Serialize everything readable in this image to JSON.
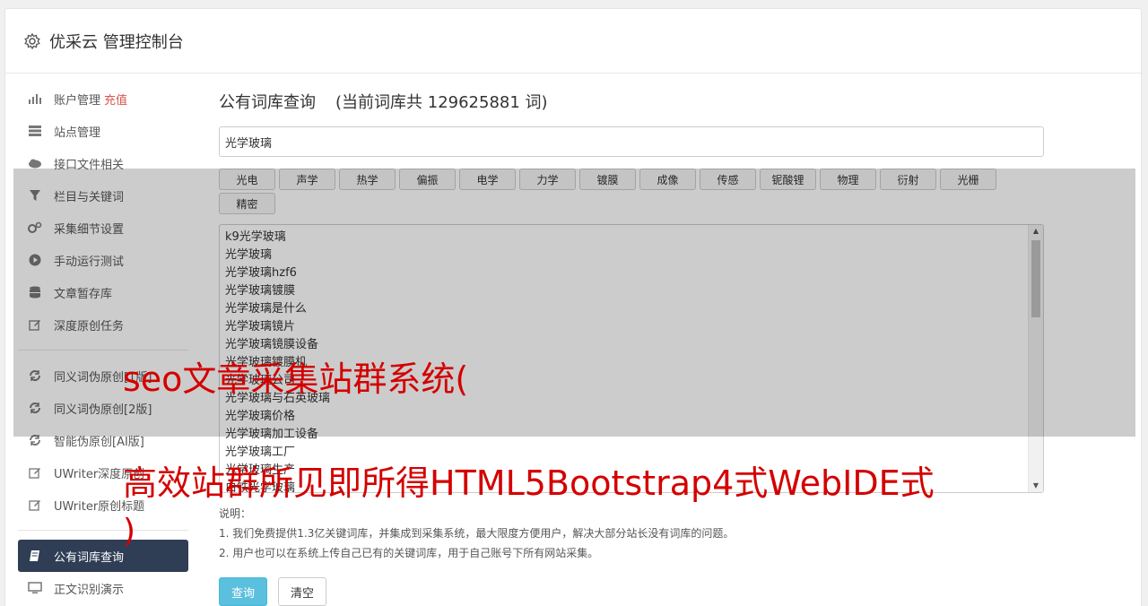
{
  "header": {
    "title": "优采云 管理控制台",
    "icon": "gear-icon"
  },
  "sidebar": {
    "items": [
      {
        "label": "账户管理",
        "extra": "充值",
        "icon": "bar-chart-icon"
      },
      {
        "label": "站点管理",
        "icon": "server-icon"
      },
      {
        "label": "接口文件相关",
        "icon": "cloud-upload-icon"
      },
      {
        "label": "栏目与关键词",
        "icon": "filter-icon"
      },
      {
        "label": "采集细节设置",
        "icon": "gears-icon"
      },
      {
        "label": "手动运行测试",
        "icon": "play-circle-icon"
      },
      {
        "label": "文章暂存库",
        "icon": "database-icon"
      },
      {
        "label": "深度原创任务",
        "icon": "edit-icon"
      },
      {
        "label": "同义词伪原创[1版]",
        "icon": "refresh-icon"
      },
      {
        "label": "同义词伪原创[2版]",
        "icon": "refresh-icon"
      },
      {
        "label": "智能伪原创[AI版]",
        "icon": "refresh-icon"
      },
      {
        "label": "UWriter深度原创",
        "icon": "edit-icon"
      },
      {
        "label": "UWriter原创标题",
        "icon": "edit-icon"
      },
      {
        "label": "公有词库查询",
        "icon": "book-icon"
      },
      {
        "label": "正文识别演示",
        "icon": "monitor-icon"
      }
    ]
  },
  "main": {
    "title": "公有词库查询",
    "count_text": "(当前词库共 129625881 词)",
    "search_value": "光学玻璃",
    "tags": [
      "光电",
      "声学",
      "热学",
      "偏振",
      "电学",
      "力学",
      "镀膜",
      "成像",
      "传感",
      "铌酸锂",
      "物理",
      "衍射",
      "光栅",
      "精密"
    ],
    "words": [
      "k9光学玻璃",
      "光学玻璃",
      "光学玻璃hzf6",
      "光学玻璃镀膜",
      "光学玻璃是什么",
      "光学玻璃镜片",
      "光学玻璃镜膜设备",
      "光学玻璃镀膜机",
      "光学玻璃公司",
      "光学玻璃与石英玻璃",
      "光学玻璃价格",
      "光学玻璃加工设备",
      "光学玻璃工厂",
      "光学玻璃生产",
      "白铁光学玻璃"
    ],
    "notes": {
      "heading": "说明：",
      "line1": "1. 我们免费提供1.3亿关键词库，并集成到采集系统，最大限度方便用户，解决大部分站长没有词库的问题。",
      "line2": "2. 用户也可以在系统上传自己已有的关键词库，用于自己账号下所有网站采集。"
    },
    "buttons": {
      "query": "查询",
      "clear": "清空"
    }
  },
  "watermark": {
    "line1": "seo文章采集站群系统(",
    "line2": "高效站群所见即所得HTML5Bootstrap4式WebIDE式",
    "line3": ")"
  }
}
